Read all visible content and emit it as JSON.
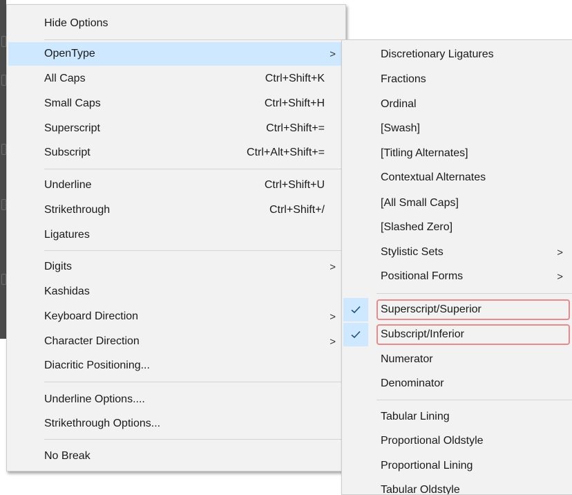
{
  "main_menu": {
    "items": [
      {
        "label": "Hide Options",
        "shortcut": "",
        "submenu": false
      },
      {
        "label": "OpenType",
        "shortcut": "",
        "submenu": true,
        "highlighted": true
      },
      {
        "label": "All Caps",
        "shortcut": "Ctrl+Shift+K",
        "submenu": false
      },
      {
        "label": "Small Caps",
        "shortcut": "Ctrl+Shift+H",
        "submenu": false
      },
      {
        "label": "Superscript",
        "shortcut": "Ctrl+Shift+=",
        "submenu": false
      },
      {
        "label": "Subscript",
        "shortcut": "Ctrl+Alt+Shift+=",
        "submenu": false
      },
      {
        "label": "Underline",
        "shortcut": "Ctrl+Shift+U",
        "submenu": false
      },
      {
        "label": "Strikethrough",
        "shortcut": "Ctrl+Shift+/",
        "submenu": false
      },
      {
        "label": "Ligatures",
        "shortcut": "",
        "submenu": false
      },
      {
        "label": "Digits",
        "shortcut": "",
        "submenu": true
      },
      {
        "label": "Kashidas",
        "shortcut": "",
        "submenu": false
      },
      {
        "label": "Keyboard Direction",
        "shortcut": "",
        "submenu": true
      },
      {
        "label": "Character Direction",
        "shortcut": "",
        "submenu": true
      },
      {
        "label": "Diacritic Positioning...",
        "shortcut": "",
        "submenu": false
      },
      {
        "label": "Underline Options....",
        "shortcut": "",
        "submenu": false
      },
      {
        "label": "Strikethrough Options...",
        "shortcut": "",
        "submenu": false
      },
      {
        "label": "No Break",
        "shortcut": "",
        "submenu": false
      }
    ]
  },
  "opentype_submenu": {
    "items": [
      {
        "label": "Discretionary Ligatures",
        "checked": false,
        "submenu": false
      },
      {
        "label": "Fractions",
        "checked": false,
        "submenu": false
      },
      {
        "label": "Ordinal",
        "checked": false,
        "submenu": false
      },
      {
        "label": "[Swash]",
        "checked": false,
        "submenu": false
      },
      {
        "label": "[Titling Alternates]",
        "checked": false,
        "submenu": false
      },
      {
        "label": "Contextual Alternates",
        "checked": false,
        "submenu": false
      },
      {
        "label": "[All Small Caps]",
        "checked": false,
        "submenu": false
      },
      {
        "label": "[Slashed Zero]",
        "checked": false,
        "submenu": false
      },
      {
        "label": "Stylistic Sets",
        "checked": false,
        "submenu": true
      },
      {
        "label": "Positional Forms",
        "checked": false,
        "submenu": true
      },
      {
        "label": "Superscript/Superior",
        "checked": true,
        "submenu": false,
        "annotated": true
      },
      {
        "label": "Subscript/Inferior",
        "checked": true,
        "submenu": false,
        "annotated": true
      },
      {
        "label": "Numerator",
        "checked": false,
        "submenu": false
      },
      {
        "label": "Denominator",
        "checked": false,
        "submenu": false
      },
      {
        "label": "Tabular Lining",
        "checked": false,
        "submenu": false
      },
      {
        "label": "Proportional Oldstyle",
        "checked": false,
        "submenu": false
      },
      {
        "label": "Proportional Lining",
        "checked": false,
        "submenu": false
      },
      {
        "label": "Tabular Oldstyle",
        "checked": false,
        "submenu": false
      }
    ]
  },
  "glyphs": {
    "submenu_arrow": ">",
    "check": "check-icon"
  },
  "colors": {
    "highlight": "#cde8ff",
    "annotation_border": "#e8898c",
    "menu_bg": "#f2f2f2"
  }
}
